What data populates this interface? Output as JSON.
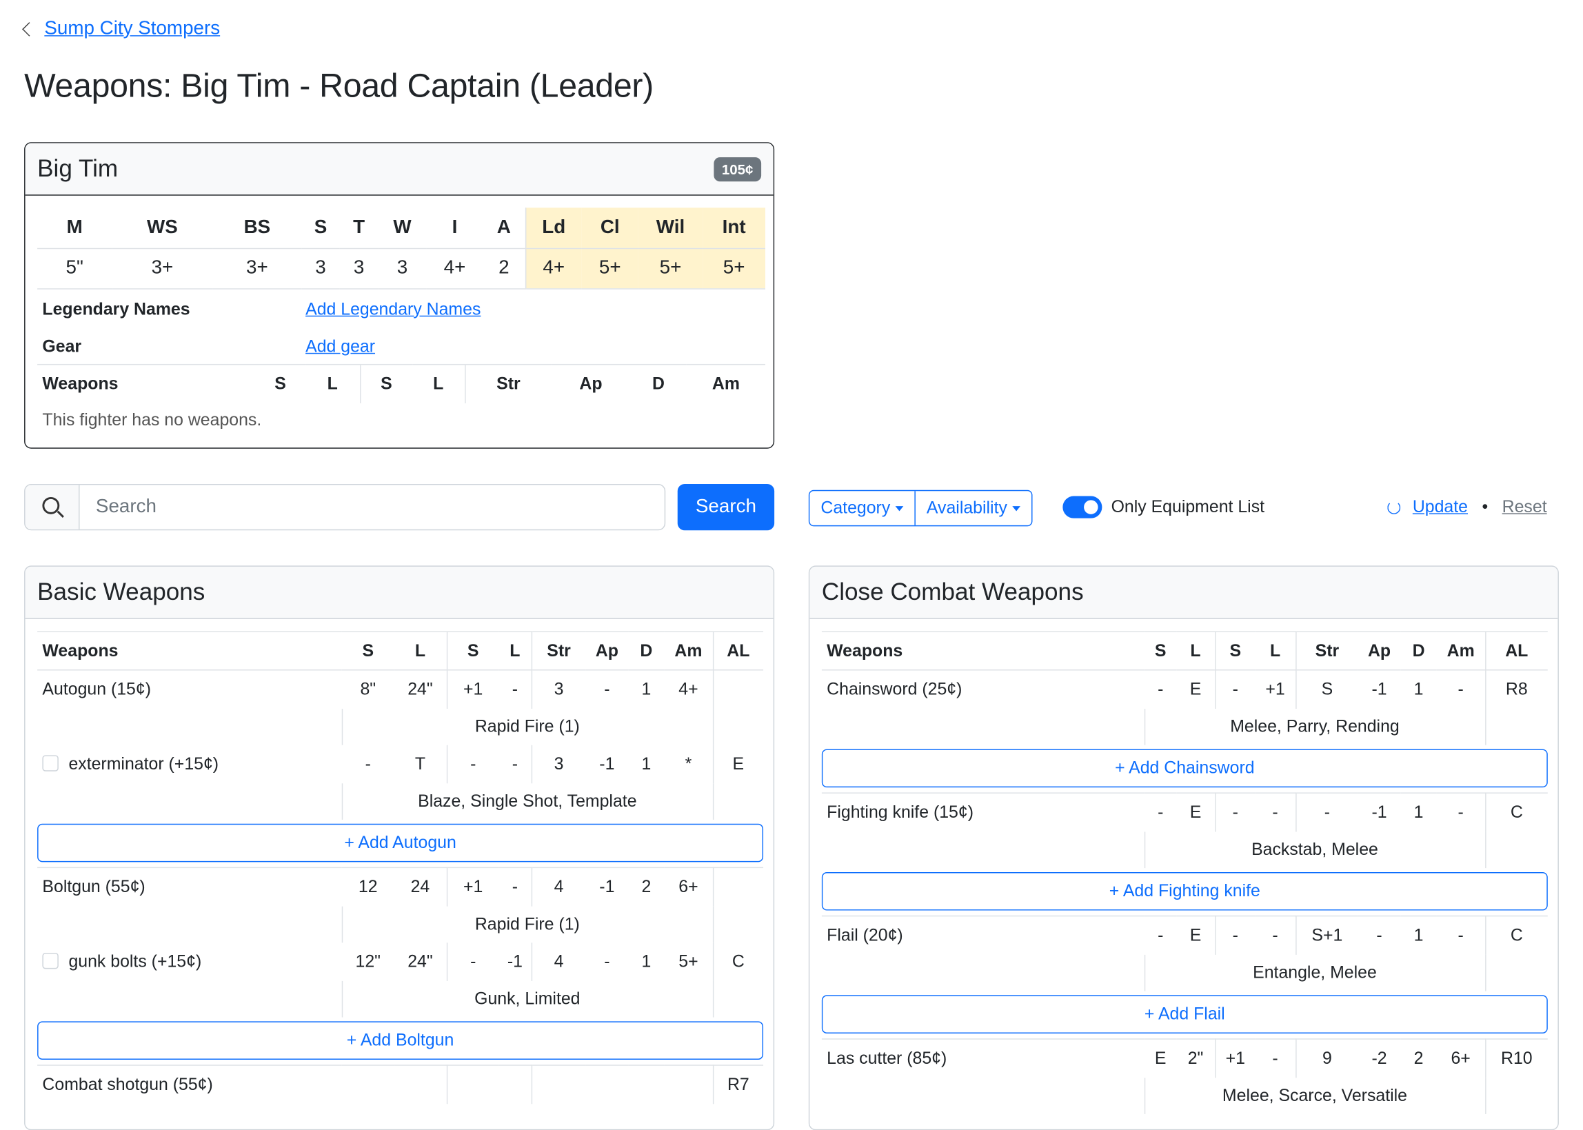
{
  "breadcrumb": {
    "back_label": "Sump City Stompers"
  },
  "page_title": "Weapons: Big Tim - Road Captain (Leader)",
  "fighter": {
    "name": "Big Tim",
    "cost": "105¢",
    "stat_headers": [
      "M",
      "WS",
      "BS",
      "S",
      "T",
      "W",
      "I",
      "A",
      "Ld",
      "Cl",
      "Wil",
      "Int"
    ],
    "stat_values": [
      "5\"",
      "3+",
      "3+",
      "3",
      "3",
      "3",
      "4+",
      "2",
      "4+",
      "5+",
      "5+",
      "5+"
    ],
    "legendary_label": "Legendary Names",
    "legendary_link": "Add Legendary Names",
    "gear_label": "Gear",
    "gear_link": "Add gear",
    "weapons_headers": [
      "Weapons",
      "S",
      "L",
      "S",
      "L",
      "Str",
      "Ap",
      "D",
      "Am"
    ],
    "no_weapons": "This fighter has no weapons."
  },
  "filters": {
    "search_placeholder": "Search",
    "search_button": "Search",
    "category_label": "Category",
    "availability_label": "Availability",
    "only_equipment_label": "Only Equipment List",
    "only_equipment_on": true,
    "update_label": "Update",
    "reset_label": "Reset"
  },
  "basic": {
    "title": "Basic Weapons",
    "headers": [
      "Weapons",
      "S",
      "L",
      "S",
      "L",
      "Str",
      "Ap",
      "D",
      "Am",
      "AL"
    ],
    "autogun": {
      "name": "Autogun (15¢)",
      "stats": [
        "8\"",
        "24\"",
        "+1",
        "-",
        "3",
        "-",
        "1",
        "4+",
        ""
      ],
      "traits": "Rapid Fire (1)",
      "upgrade": {
        "name": "exterminator (+15¢)",
        "stats": [
          "-",
          "T",
          "-",
          "-",
          "3",
          "-1",
          "1",
          "*",
          "E"
        ],
        "traits": "Blaze, Single Shot, Template"
      },
      "add": "Add Autogun"
    },
    "boltgun": {
      "name": "Boltgun (55¢)",
      "stats": [
        "12",
        "24",
        "+1",
        "-",
        "4",
        "-1",
        "2",
        "6+",
        ""
      ],
      "traits": "Rapid Fire (1)",
      "upgrade": {
        "name": "gunk bolts (+15¢)",
        "stats": [
          "12\"",
          "24\"",
          "-",
          "-1",
          "4",
          "-",
          "1",
          "5+",
          "C"
        ],
        "traits": "Gunk, Limited"
      },
      "add": "Add Boltgun"
    },
    "shotgun": {
      "name": "Combat shotgun (55¢)",
      "al": "R7"
    }
  },
  "close": {
    "title": "Close Combat Weapons",
    "headers": [
      "Weapons",
      "S",
      "L",
      "S",
      "L",
      "Str",
      "Ap",
      "D",
      "Am",
      "AL"
    ],
    "chainsword": {
      "name": "Chainsword (25¢)",
      "stats": [
        "-",
        "E",
        "-",
        "+1",
        "S",
        "-1",
        "1",
        "-",
        "R8"
      ],
      "traits": "Melee, Parry, Rending",
      "add": "Add Chainsword"
    },
    "knife": {
      "name": "Fighting knife (15¢)",
      "stats": [
        "-",
        "E",
        "-",
        "-",
        "-",
        "-1",
        "1",
        "-",
        "C"
      ],
      "traits": "Backstab, Melee",
      "add": "Add Fighting knife"
    },
    "flail": {
      "name": "Flail (20¢)",
      "stats": [
        "-",
        "E",
        "-",
        "-",
        "S+1",
        "-",
        "1",
        "-",
        "C"
      ],
      "traits": "Entangle, Melee",
      "add": "Add Flail"
    },
    "lascutter": {
      "name": "Las cutter (85¢)",
      "stats": [
        "E",
        "2\"",
        "+1",
        "-",
        "9",
        "-2",
        "2",
        "6+",
        "R10"
      ],
      "traits": "Melee, Scarce, Versatile"
    }
  }
}
